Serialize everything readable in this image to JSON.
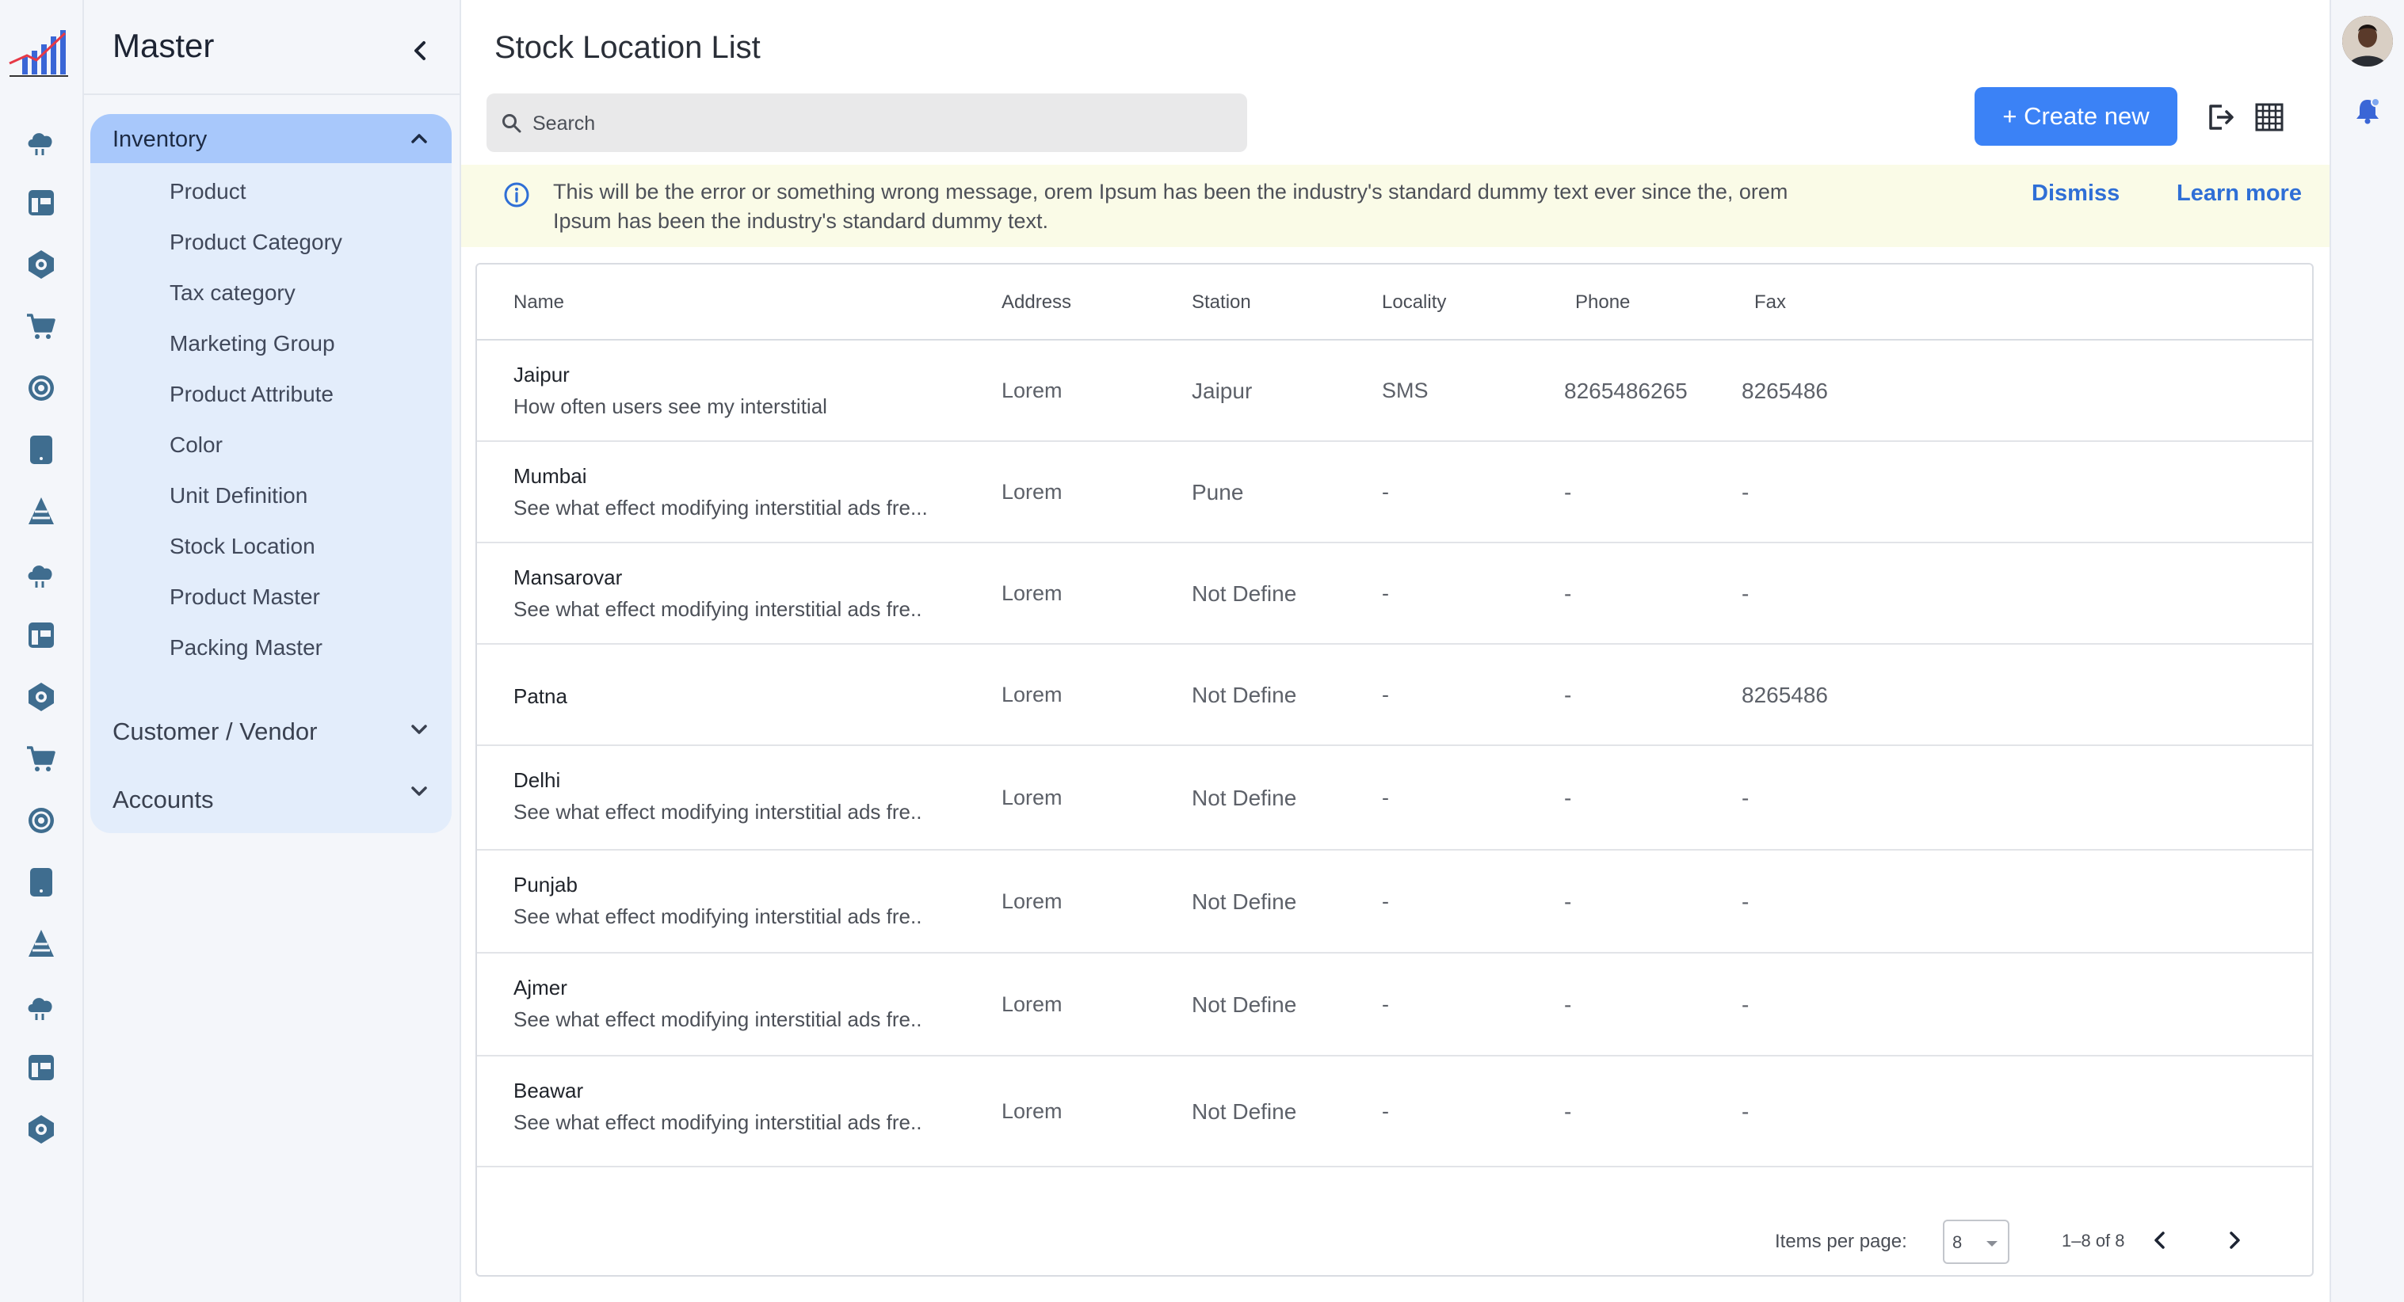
{
  "sidebar": {
    "title": "Master",
    "inventory": {
      "label": "Inventory",
      "items": [
        {
          "label": "Product"
        },
        {
          "label": "Product Category"
        },
        {
          "label": "Tax category"
        },
        {
          "label": "Marketing Group"
        },
        {
          "label": "Product Attribute"
        },
        {
          "label": "Color"
        },
        {
          "label": "Unit Definition"
        },
        {
          "label": "Stock Location"
        },
        {
          "label": "Product Master"
        },
        {
          "label": "Packing Master"
        }
      ]
    },
    "customer_vendor": {
      "label": "Customer / Vendor"
    },
    "accounts": {
      "label": "Accounts"
    }
  },
  "header": {
    "title": "Stock Location List",
    "search_placeholder": "Search",
    "create_label": "+ Create new"
  },
  "banner": {
    "message": "This will be the error or something wrong message, orem Ipsum has been the industry's standard dummy text ever since the, orem Ipsum has been the industry's standard dummy text.",
    "dismiss": "Dismiss",
    "learn_more": "Learn more"
  },
  "table": {
    "columns": [
      "Name",
      "Address",
      "Station",
      "Locality",
      "Phone",
      "Fax"
    ],
    "rows": [
      {
        "name": "Jaipur",
        "desc": "How often users see my interstitial",
        "address": "Lorem",
        "station": "Jaipur",
        "locality": "SMS",
        "phone": "8265486265",
        "fax": "8265486"
      },
      {
        "name": "Mumbai",
        "desc": "See what effect modifying interstitial ads fre...",
        "address": "Lorem",
        "station": "Pune",
        "locality": "-",
        "phone": "-",
        "fax": "-"
      },
      {
        "name": "Mansarovar",
        "desc": "See what effect modifying interstitial ads fre..",
        "address": "Lorem",
        "station": "Not Define",
        "locality": "-",
        "phone": "-",
        "fax": "-"
      },
      {
        "name": "Patna",
        "desc": "",
        "address": "Lorem",
        "station": "Not Define",
        "locality": "-",
        "phone": "-",
        "fax": "8265486"
      },
      {
        "name": "Delhi",
        "desc": "See what effect modifying interstitial ads fre..",
        "address": "Lorem",
        "station": "Not Define",
        "locality": "-",
        "phone": "-",
        "fax": "-"
      },
      {
        "name": "Punjab",
        "desc": "See what effect modifying interstitial ads fre..",
        "address": "Lorem",
        "station": "Not Define",
        "locality": "-",
        "phone": "-",
        "fax": "-"
      },
      {
        "name": "Ajmer",
        "desc": "See what effect modifying interstitial ads fre..",
        "address": "Lorem",
        "station": "Not Define",
        "locality": "-",
        "phone": "-",
        "fax": "-"
      },
      {
        "name": "Beawar",
        "desc": "See what effect modifying interstitial ads fre..",
        "address": "Lorem",
        "station": "Not Define",
        "locality": "-",
        "phone": "-",
        "fax": "-"
      }
    ]
  },
  "pagination": {
    "items_per_page_label": "Items per page:",
    "items_per_page": "8",
    "range": "1–8 of 8"
  },
  "colors": {
    "accent": "#3b82f6",
    "link": "#2f6fd6",
    "banner_bg": "#fafbe7",
    "active_group": "#a8c8fb"
  },
  "icons": {
    "rail": [
      "cloud-icon",
      "layout-icon",
      "globe-icon",
      "cart-icon",
      "atom-icon",
      "tablet-icon",
      "cone-icon",
      "cloud-icon",
      "layout-icon",
      "globe-icon",
      "cart-icon",
      "atom-icon",
      "tablet-icon",
      "cone-icon",
      "cloud-icon",
      "layout-icon",
      "globe-icon"
    ]
  }
}
